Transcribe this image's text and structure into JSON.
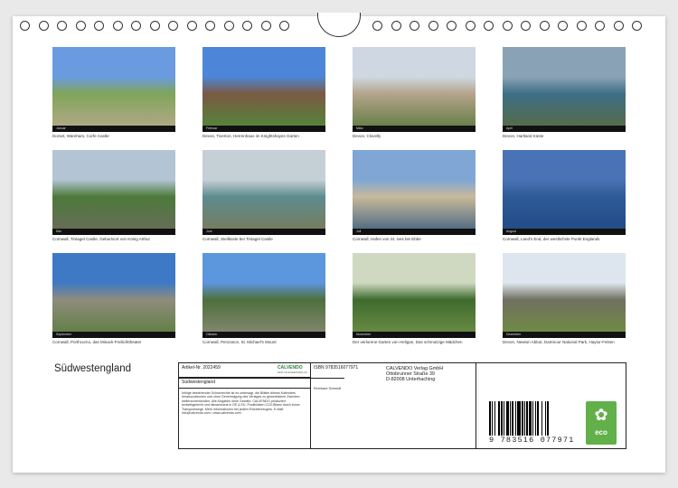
{
  "title": "Südwestengland",
  "photos": [
    {
      "month": "Januar",
      "caption": "Dorset, Wareham, Corfe Castle",
      "colors": [
        "#6a9be0",
        "#7fa55a",
        "#b9a98c"
      ]
    },
    {
      "month": "Februar",
      "caption": "Devon, Tiverton, Herrenhaus im Knightshayes Garten",
      "colors": [
        "#4d86d8",
        "#7a5a42",
        "#4f8a3a"
      ]
    },
    {
      "month": "März",
      "caption": "Devon, Clovelly",
      "colors": [
        "#cfd8e2",
        "#b4a48c",
        "#5b7a3c"
      ]
    },
    {
      "month": "April",
      "caption": "Devon, Hartland Küste",
      "colors": [
        "#8aa2b5",
        "#3e6f86",
        "#5a6b40"
      ]
    },
    {
      "month": "Mai",
      "caption": "Cornwall, Tintagel Castle, Geburtsort von König Arthur",
      "colors": [
        "#b3c4d4",
        "#4d7a3a",
        "#6a6a5c"
      ]
    },
    {
      "month": "Juni",
      "caption": "Cornwall, Steilküste bei Tintagel Castle",
      "colors": [
        "#c5cfd6",
        "#5d8c8f",
        "#7a7a58"
      ]
    },
    {
      "month": "Juli",
      "caption": "Cornwall, Hafen von St. Ives bei Ebbe",
      "colors": [
        "#7fa6d4",
        "#c8b99a",
        "#3c5f80"
      ]
    },
    {
      "month": "August",
      "caption": "Cornwall, Land's End, der westlichste Punkt Englands",
      "colors": [
        "#4a73b5",
        "#2e5a96",
        "#1f4a85"
      ]
    },
    {
      "month": "September",
      "caption": "Cornwall, Porthcurno, das Minack-Freilichttheater",
      "colors": [
        "#3d79c4",
        "#8f8c7c",
        "#5a7d3d"
      ]
    },
    {
      "month": "Oktober",
      "caption": "Cornwall, Penzance, St. Michael's Mount",
      "colors": [
        "#5c96dd",
        "#4f6f3c",
        "#8a8a78"
      ]
    },
    {
      "month": "November",
      "caption": "Der verlorene Garten von Heligan, Das schmutzige Mädchen",
      "colors": [
        "#cfd9c2",
        "#3e6b2d",
        "#6f8f48"
      ]
    },
    {
      "month": "Dezember",
      "caption": "Devon, Newton Abbot, Dartmoor National Park, Haytor-Felsen",
      "colors": [
        "#dde6ee",
        "#707060",
        "#6f8f3f"
      ]
    }
  ],
  "info": {
    "article_label": "Artikel-Nr. 2022459",
    "brand": "CALVENDO",
    "brand_sub": "DER KALENDERVERLAG",
    "calendar_title": "Südwestengland",
    "legal_text": "Infolge bestehender Schutzrechte ist es untersagt, die Blätter dieses Kalenders herauszutrennen und ohne Genehmigung des Verlages zu gewerblichen Zwecken weiterzuverwenden. Alle Angaben ohne Gewähr. CALVENDO produziert bedarfsgerecht und klimaneutral in DE & EU. Positivlisten CO2-Bilanz durch kurze Transportwege. Mehr Informationen bei jedem Einzelerzeugnis. E-Mail: info@calvendo.com • www.calvendo.com",
    "isbn_label": "ISBN 9783516077971",
    "author": "Reinhard Schmidt",
    "publisher_lines": [
      "CALVENDO Verlag GmbH",
      "Ottobrunner Straße 39",
      "D-82008 Unterhaching"
    ],
    "barcode_digits": "9 783516 077971",
    "eco_label": "eco"
  }
}
